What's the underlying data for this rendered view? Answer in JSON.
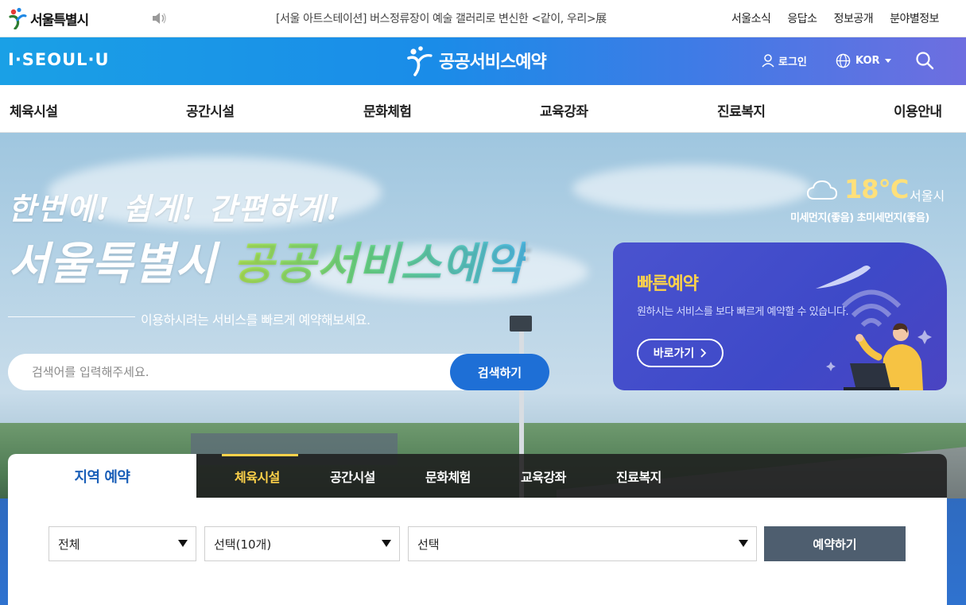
{
  "topbar": {
    "logo_text": "서울특별시",
    "ticker": "[서울 아트스테이션] 버스정류장이 예술 갤러리로 변신한 <같이, 우리>展",
    "links": [
      "서울소식",
      "응답소",
      "정보공개",
      "분야별정보"
    ]
  },
  "header": {
    "slogan": "I·SEOUL·U",
    "brand": "공공서비스예약",
    "login": "로그인",
    "lang": "KOR"
  },
  "nav": {
    "items": [
      "체육시설",
      "공간시설",
      "문화체험",
      "교육강좌",
      "진료복지",
      "이용안내"
    ]
  },
  "hero": {
    "line1": "한번에! 쉽게! 간편하게!",
    "line2_a": "서울특별시",
    "line2_b": "공공서비스예약",
    "sub": "이용하시려는 서비스를 빠르게 예약해보세요.",
    "search_placeholder": "검색어를 입력해주세요.",
    "search_button": "검색하기"
  },
  "weather": {
    "temp": "18℃",
    "city": "서울시",
    "dust": "미세먼지(좋음) 초미세먼지(좋음)"
  },
  "quick": {
    "title": "빠른예약",
    "desc": "원하시는 서비스를 보다 빠르게 예약할 수 있습니다.",
    "go": "바로가기"
  },
  "panel": {
    "region_tab": "지역 예약",
    "tabs": [
      "체육시설",
      "공간시설",
      "문화체험",
      "교육강좌",
      "진료복지"
    ],
    "active_tab": "체육시설",
    "select1": "전체",
    "select2": "선택(10개)",
    "select3": "선택",
    "reserve": "예약하기"
  },
  "colors": {
    "primary_blue": "#1e6fd6",
    "accent_yellow": "#ffd24a",
    "quick_card": "#4a53cf",
    "reserve_btn": "#4e5e6f"
  }
}
